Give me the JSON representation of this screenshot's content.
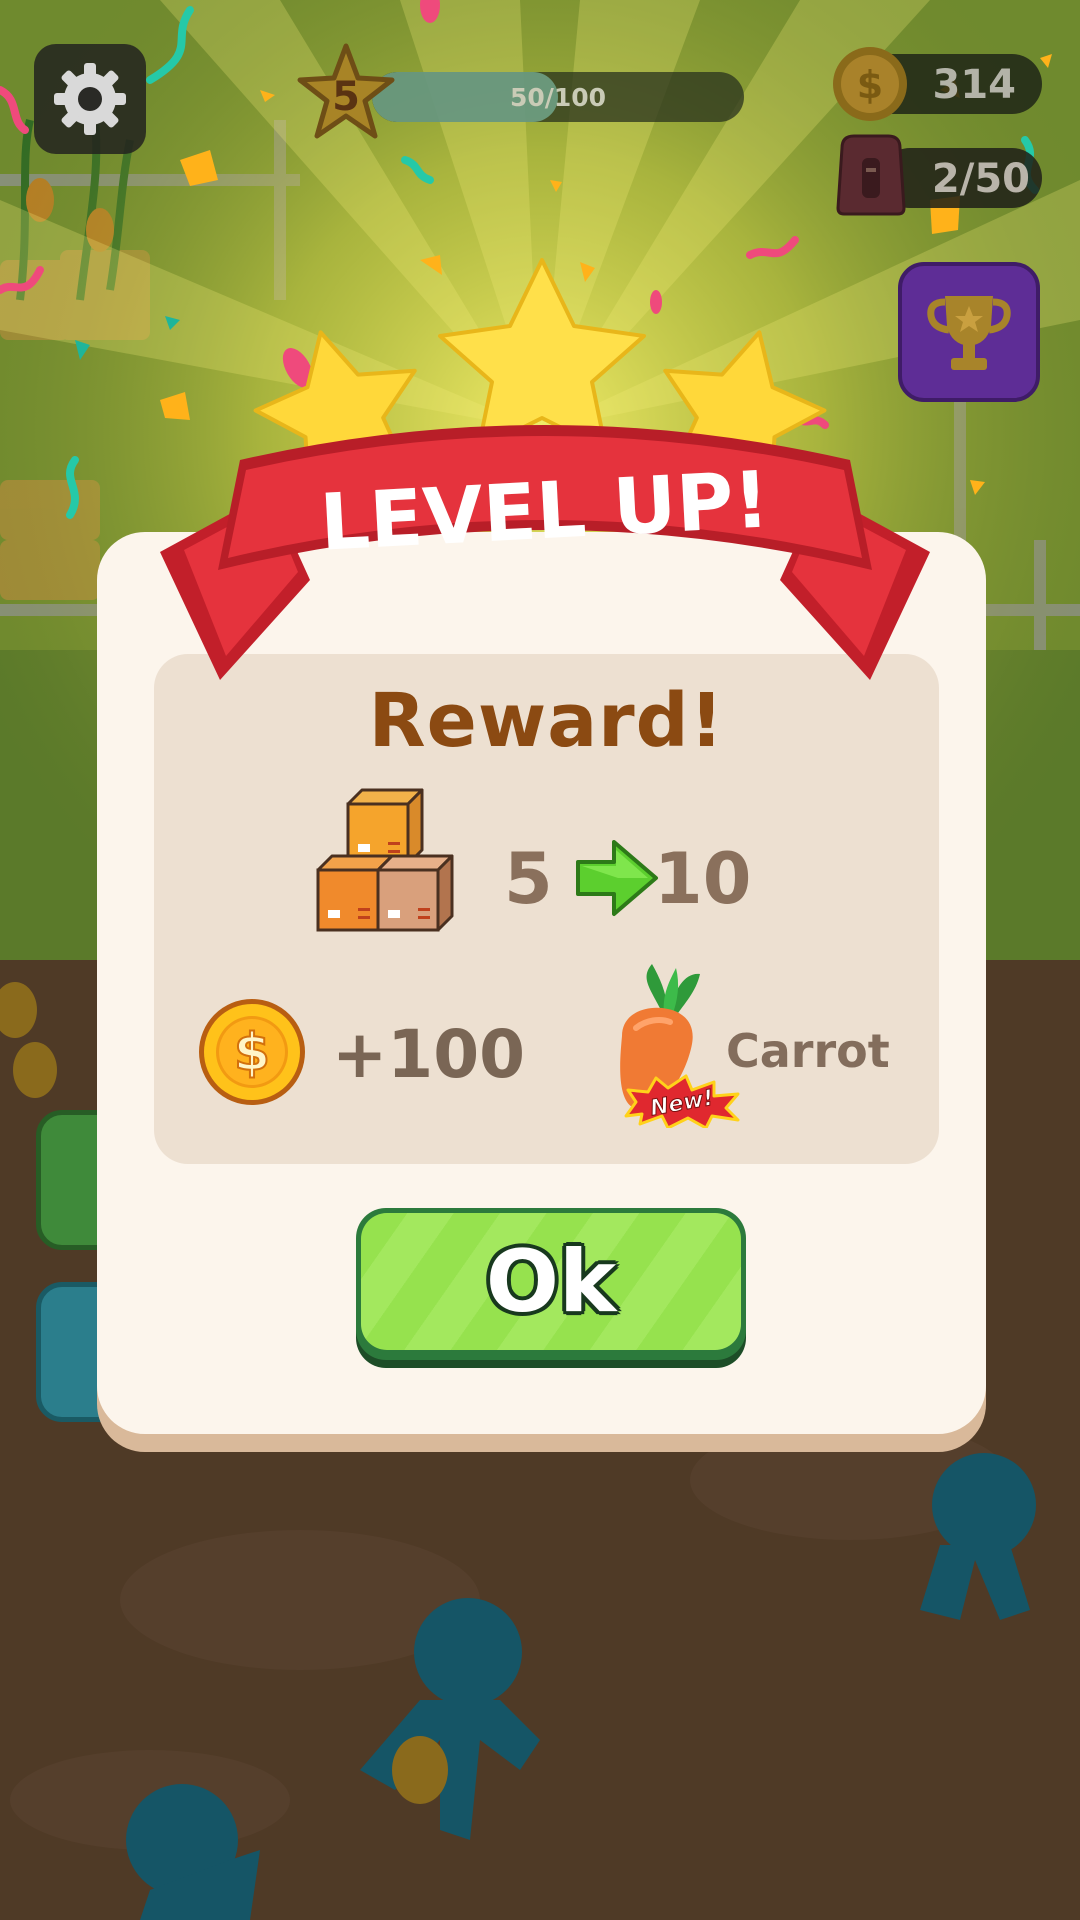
{
  "hud": {
    "level_number": "5",
    "level_progress_text": "50/100",
    "level_progress_fraction": 0.5,
    "coins": "314",
    "storage": "2/50"
  },
  "dialog": {
    "header": "LEVEL UP!",
    "reward_title": "Reward!",
    "capacity_from": "5",
    "capacity_to": "10",
    "coin_reward": "+100",
    "new_item_badge": "New!",
    "new_item_name": "Carrot",
    "ok_label": "Ok"
  },
  "icons": {
    "settings": "gear-icon",
    "level": "star-icon",
    "coins": "coin-icon",
    "storage": "backpack-icon",
    "trophy": "trophy-icon",
    "capacity": "boxes-icon",
    "arrow": "arrow-right-icon",
    "new_item": "carrot-icon"
  },
  "colors": {
    "ribbon_red": "#e5333d",
    "reward_brown": "#8b4a12",
    "ok_green": "#96e24e",
    "panel_cream": "#fcf5ec"
  }
}
